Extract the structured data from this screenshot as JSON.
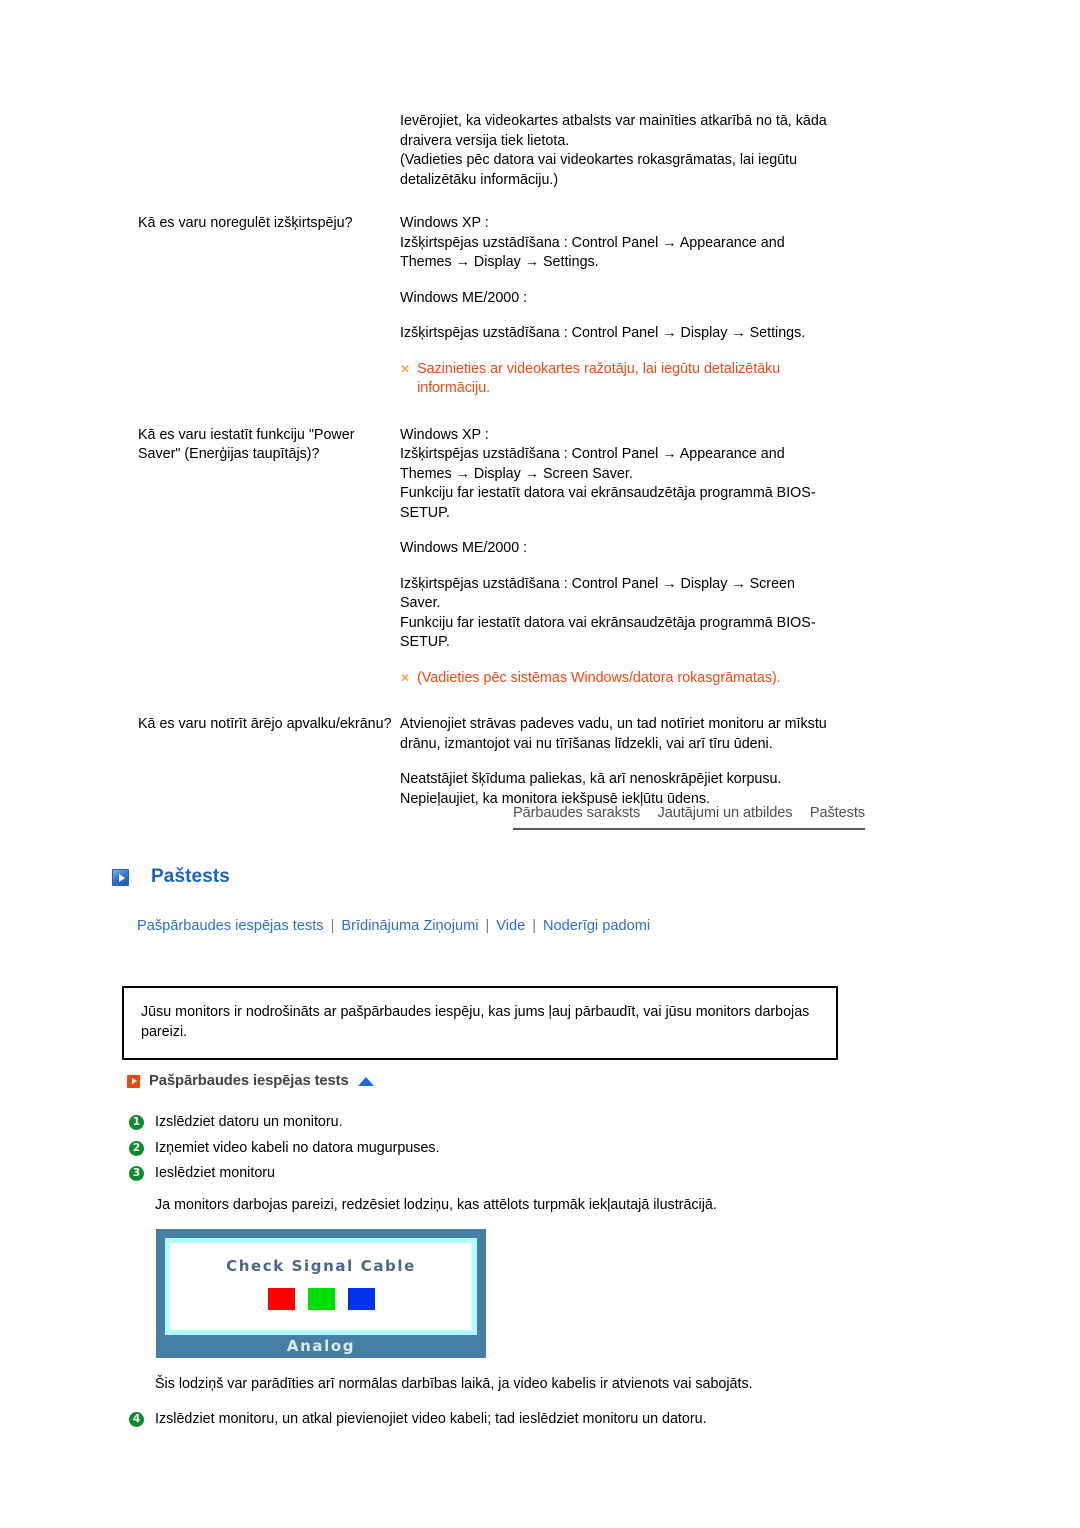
{
  "faq": {
    "intro_answer": [
      "Ievērojiet, ka videokartes atbalsts var mainīties atkarībā no tā, kāda draivera versija tiek lietota.",
      "(Vadieties pēc datora vai videokartes rokasgrāmatas, lai iegūtu detalizētāku informāciju.)"
    ],
    "rows": [
      {
        "question": "Kā es varu noregulēt izšķirtspēju?",
        "blocks": [
          "Windows XP :",
          "Izšķirtspējas uzstādīšana : Control Panel → Appearance and Themes → Display → Settings.",
          "Windows ME/2000 :",
          "Izšķirtspējas uzstādīšana : Control Panel → Display → Settings."
        ],
        "note": "Sazinieties ar videokartes ražotāju, lai iegūtu detalizētāku informāciju."
      },
      {
        "question": "Kā es varu iestatīt funkciju \"Power Saver\" (Enerģijas taupītājs)?",
        "blocks": [
          "Windows XP :",
          "Izšķirtspējas uzstādīšana : Control Panel → Appearance and Themes → Display → Screen Saver.",
          "Funkciju far iestatīt datora vai ekrānsaudzētāja programmā BIOS-SETUP.",
          "Windows ME/2000 :",
          "Izšķirtspējas uzstādīšana : Control Panel → Display → Screen Saver.",
          "Funkciju far iestatīt datora vai ekrānsaudzētāja programmā BIOS-SETUP."
        ],
        "note": "(Vadieties pēc sistēmas Windows/datora rokasgrāmatas)."
      },
      {
        "question": "Kā es varu notīrīt ārējo apvalku/ekrānu?",
        "blocks": [
          "Atvienojiet strāvas padeves vadu, un tad notīriet monitoru ar mīkstu drānu, izmantojot vai nu tīrīšanas līdzekli, vai arī tīru ūdeni.",
          "Neatstājiet šķīduma paliekas, kā arī nenoskrāpējiet korpusu. Nepieļaujiet, ka monitora iekšpusē iekļūtu ūdens."
        ],
        "note": null
      }
    ],
    "note_marker": "✕"
  },
  "tabbar": {
    "items": [
      {
        "label": "Pārbaudes saraksts"
      },
      {
        "label": "Jautājumi un atbildes"
      },
      {
        "label": "Paštests"
      }
    ]
  },
  "section": {
    "icon": "blue-arrow-icon",
    "title": "Paštests"
  },
  "links": {
    "items": [
      {
        "label": "Pašpārbaudes iespējas tests"
      },
      {
        "label": "Brīdinājuma Ziņojumi"
      },
      {
        "label": "Vide"
      },
      {
        "label": "Noderīgi padomi"
      }
    ],
    "separator": "|"
  },
  "infobox": {
    "text": "Jūsu monitors ir nodrošināts ar pašpārbaudes iespēju, kas jums ļauj pārbaudīt, vai jūsu monitors darbojas pareizi."
  },
  "subsection": {
    "icon": "orange-arrow-icon",
    "title": "Pašpārbaudes iespējas tests",
    "back_to_top_icon": "up-triangle-icon"
  },
  "steps": {
    "items": [
      {
        "num": "1",
        "text": "Izslēdziet datoru un monitoru."
      },
      {
        "num": "2",
        "text": "Izņemiet video kabeli no datora mugurpuses."
      },
      {
        "num": "3",
        "text": "Ieslēdziet monitoru"
      }
    ],
    "note": "Ja monitors darbojas pareizi, redzēsiet lodziņu, kas attēlots turpmāk iekļautajā ilustrācijā.",
    "final": {
      "num": "4",
      "text": "Izslēdziet monitoru, un atkal pievienojiet video kabeli; tad ieslēdziet monitoru un datoru."
    }
  },
  "illustration": {
    "message": "Check Signal Cable",
    "label": "Analog",
    "colors": {
      "frame": "#487ea3",
      "inner_border": "#aefcfb",
      "screen": "#ffffff",
      "text": "#46698c",
      "red": "#ff0000",
      "green": "#00dd00",
      "blue": "#0033ee"
    }
  },
  "closing": {
    "text": "Šis lodziņš var parādīties arī normālas darbības laikā, ja video kabelis ir atvienots vai sabojāts."
  },
  "palette": {
    "note_orange": "#ef4914",
    "link_blue": "#2b6fd4",
    "heading_blue": "#1c62c4",
    "step_green": "#118a2e"
  }
}
